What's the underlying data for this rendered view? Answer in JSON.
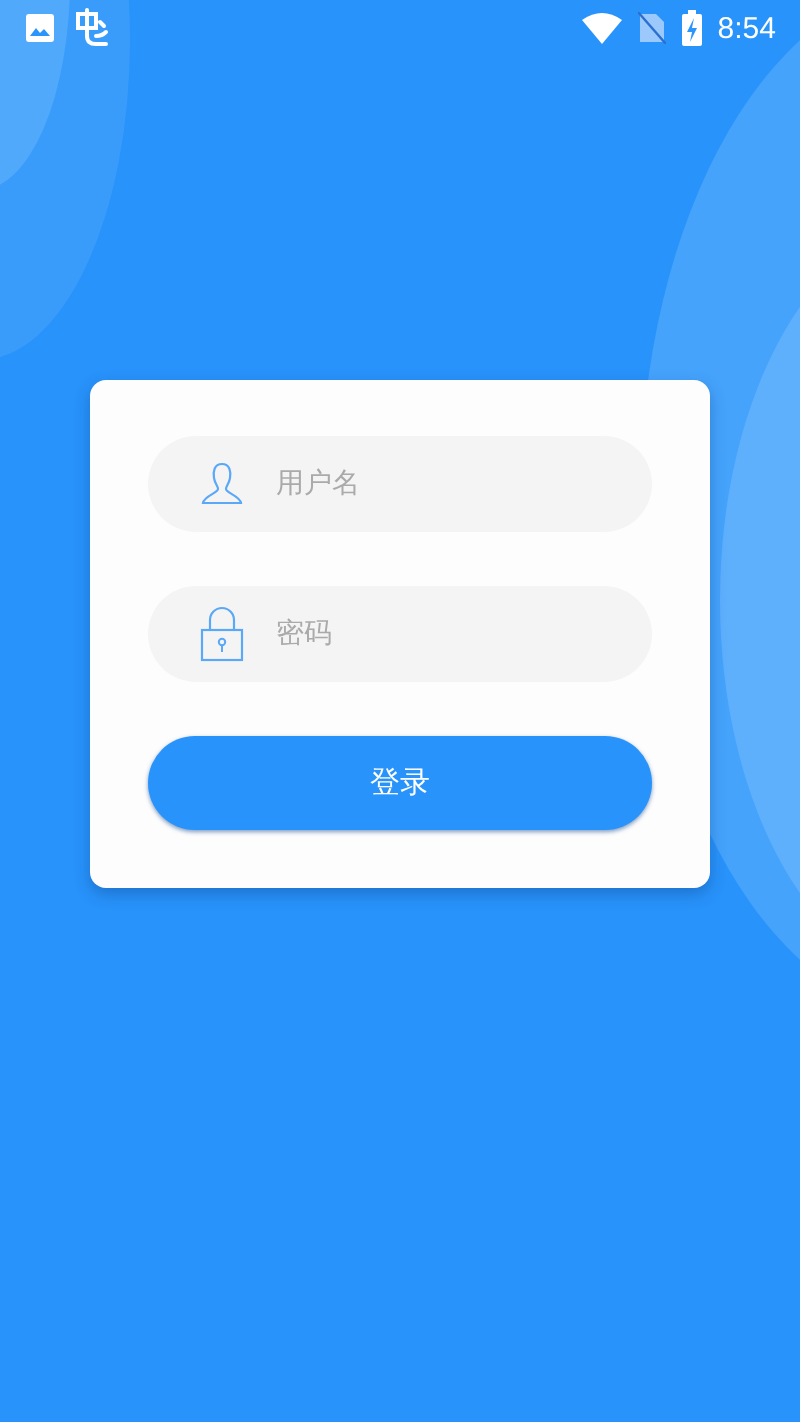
{
  "status_bar": {
    "time": "8:54"
  },
  "login_form": {
    "fields": [
      {
        "kind": "user",
        "placeholder": "用户名"
      },
      {
        "kind": "password",
        "placeholder": "密码"
      }
    ],
    "submit_button": {
      "label": "登录"
    }
  }
}
